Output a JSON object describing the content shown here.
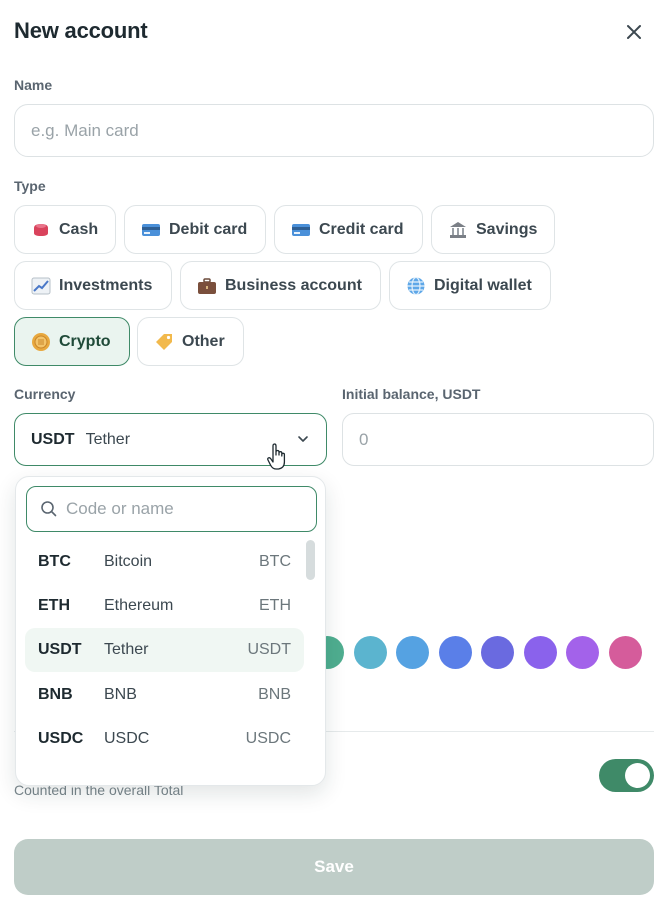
{
  "header": {
    "title": "New account",
    "close_icon": "close-icon"
  },
  "name": {
    "label": "Name",
    "placeholder": "e.g. Main card",
    "value": ""
  },
  "type": {
    "label": "Type",
    "options": [
      {
        "label": "Cash",
        "icon": "wallet-icon"
      },
      {
        "label": "Debit card",
        "icon": "debit-card-icon"
      },
      {
        "label": "Credit card",
        "icon": "credit-card-icon"
      },
      {
        "label": "Savings",
        "icon": "bank-icon"
      },
      {
        "label": "Investments",
        "icon": "chart-icon"
      },
      {
        "label": "Business account",
        "icon": "briefcase-icon"
      },
      {
        "label": "Digital wallet",
        "icon": "globe-icon"
      },
      {
        "label": "Crypto",
        "icon": "coin-icon"
      },
      {
        "label": "Other",
        "icon": "tag-icon"
      }
    ],
    "selected": "Crypto"
  },
  "currency": {
    "label": "Currency",
    "selected_code": "USDT",
    "selected_name": "Tether"
  },
  "balance": {
    "label": "Initial balance, USDT",
    "placeholder": "0"
  },
  "dropdown": {
    "search_placeholder": "Code or name",
    "items": [
      {
        "code": "BTC",
        "name": "Bitcoin",
        "symbol": "BTC"
      },
      {
        "code": "ETH",
        "name": "Ethereum",
        "symbol": "ETH"
      },
      {
        "code": "USDT",
        "name": "Tether",
        "symbol": "USDT"
      },
      {
        "code": "BNB",
        "name": "BNB",
        "symbol": "BNB"
      },
      {
        "code": "USDC",
        "name": "USDC",
        "symbol": "USDC"
      }
    ],
    "selected_index": 2
  },
  "colors": [
    "#4fae90",
    "#5bb4cf",
    "#55a2e2",
    "#5a7fe8",
    "#6a6ae0",
    "#8a62ec",
    "#a362ea",
    "#d55c9b"
  ],
  "counted": {
    "hint": "Counted in the overall Total",
    "enabled": true
  },
  "footer": {
    "save_label": "Save"
  },
  "accent": "#3f8a68"
}
